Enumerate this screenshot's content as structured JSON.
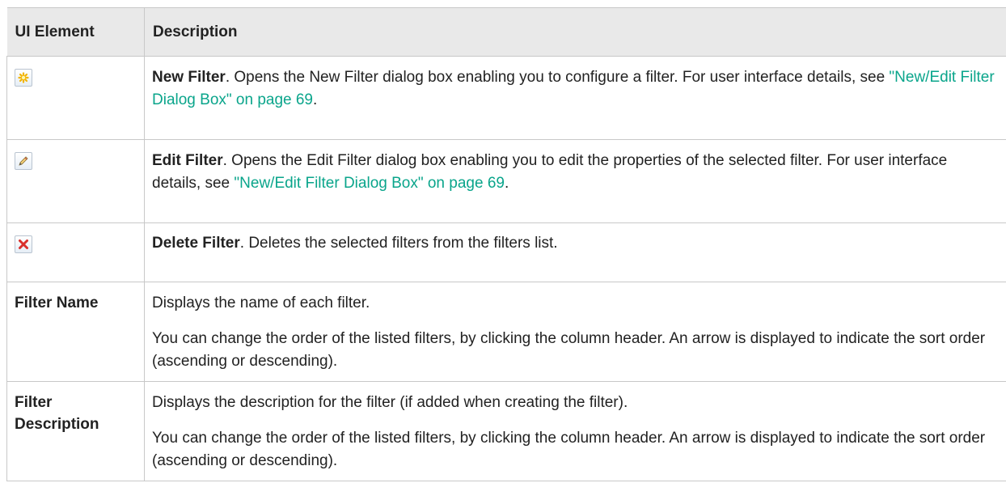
{
  "table": {
    "header": {
      "col1": "UI Element",
      "col2": "Description"
    },
    "rows": [
      {
        "icon": "new-filter-icon",
        "title": "New Filter",
        "text": ". Opens the New Filter dialog box enabling you to configure a filter. For user interface details, see ",
        "link": "\"New/Edit Filter Dialog Box\" on page 69",
        "tail": "."
      },
      {
        "icon": "edit-filter-icon",
        "title": "Edit Filter",
        "text": ". Opens the Edit Filter dialog box enabling you to edit the properties of the selected filter. For user interface details, see ",
        "link": "\"New/Edit Filter Dialog Box\" on page 69",
        "tail": "."
      },
      {
        "icon": "delete-filter-icon",
        "title": "Delete Filter",
        "text": ". Deletes the selected filters from the filters list."
      },
      {
        "label": "Filter Name",
        "p1": "Displays the name of each filter.",
        "p2": "You can change the order of the listed filters, by clicking the column header. An arrow is displayed to indicate the sort order (ascending or descending)."
      },
      {
        "label": "Filter Description",
        "p1": "Displays the description for the filter (if added when creating the filter).",
        "p2": "You can change the order of the listed filters, by clicking the column header. An arrow is displayed to indicate the sort order (ascending or descending)."
      }
    ]
  },
  "colors": {
    "link": "#0aa58b",
    "header_bg": "#e9e9e9",
    "border": "#c8c8c8"
  }
}
